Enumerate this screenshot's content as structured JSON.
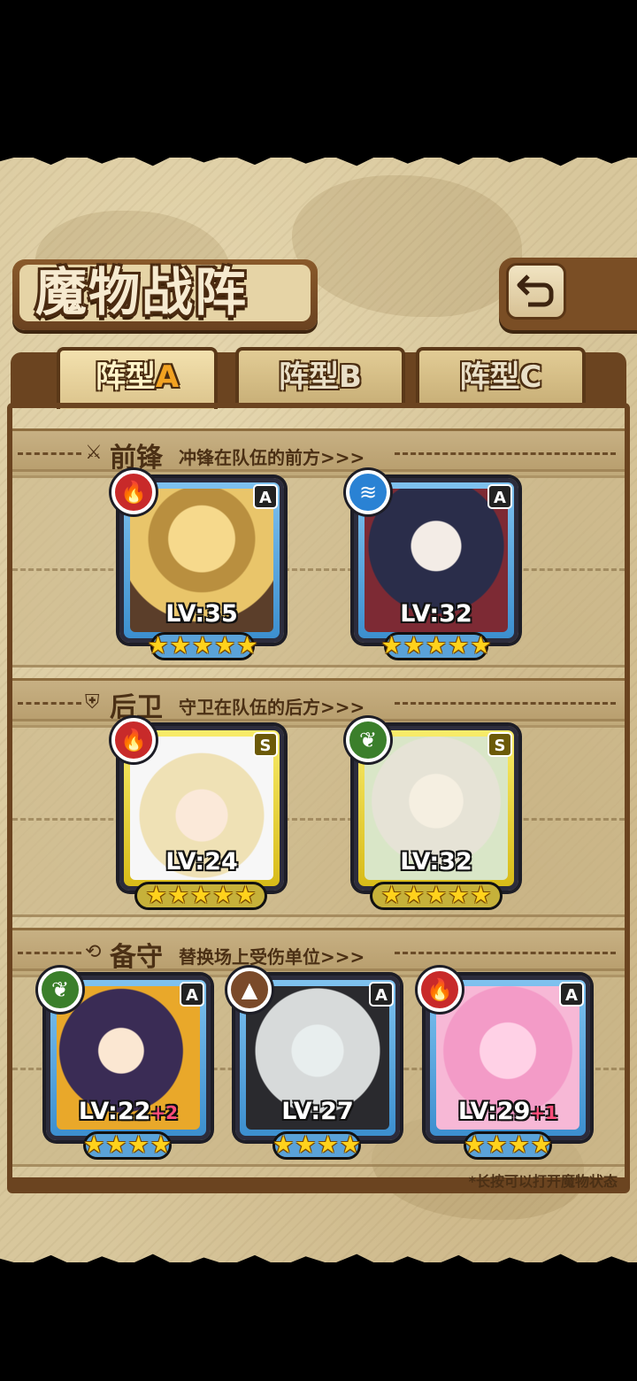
{
  "screen": {
    "title": "魔物战阵",
    "back_icon": "return-arrow-icon"
  },
  "tabs": [
    {
      "label": "阵型",
      "suffix": "A",
      "active": true
    },
    {
      "label": "阵型",
      "suffix": "B",
      "active": false
    },
    {
      "label": "阵型",
      "suffix": "C",
      "active": false
    }
  ],
  "sections": {
    "front": {
      "icon": "sword-icon",
      "label": "前锋",
      "desc": "冲锋在队伍的前方>>>"
    },
    "back": {
      "icon": "shield-icon",
      "label": "后卫",
      "desc": "守卫在队伍的后方>>>"
    },
    "reserve": {
      "icon": "swap-icon",
      "label": "备守",
      "desc": "替换场上受伤单位>>>"
    }
  },
  "front_cards": [
    {
      "element": "fire",
      "rank": "A",
      "level": "LV:35",
      "plus": "",
      "stars": 5
    },
    {
      "element": "water",
      "rank": "A",
      "level": "LV:32",
      "plus": "",
      "stars": 5
    }
  ],
  "back_cards": [
    {
      "element": "fire",
      "rank": "S",
      "level": "LV:24",
      "plus": "",
      "stars": 5
    },
    {
      "element": "wood",
      "rank": "S",
      "level": "LV:32",
      "plus": "",
      "stars": 5
    }
  ],
  "reserve_cards": [
    {
      "element": "wood",
      "rank": "A",
      "level": "LV:22",
      "plus": "+2",
      "stars": 4
    },
    {
      "element": "earth",
      "rank": "A",
      "level": "LV:27",
      "plus": "",
      "stars": 4
    },
    {
      "element": "fire",
      "rank": "A",
      "level": "LV:29",
      "plus": "+1",
      "stars": 4
    }
  ],
  "footnote": "*长按可以打开魔物状态",
  "colors": {
    "parchment": "#d8c79c",
    "frame_brown": "#6b4420",
    "rank_a_blue": "#3c8fcf",
    "rank_s_gold": "#d8bb18",
    "star_yellow": "#ffd21c"
  }
}
